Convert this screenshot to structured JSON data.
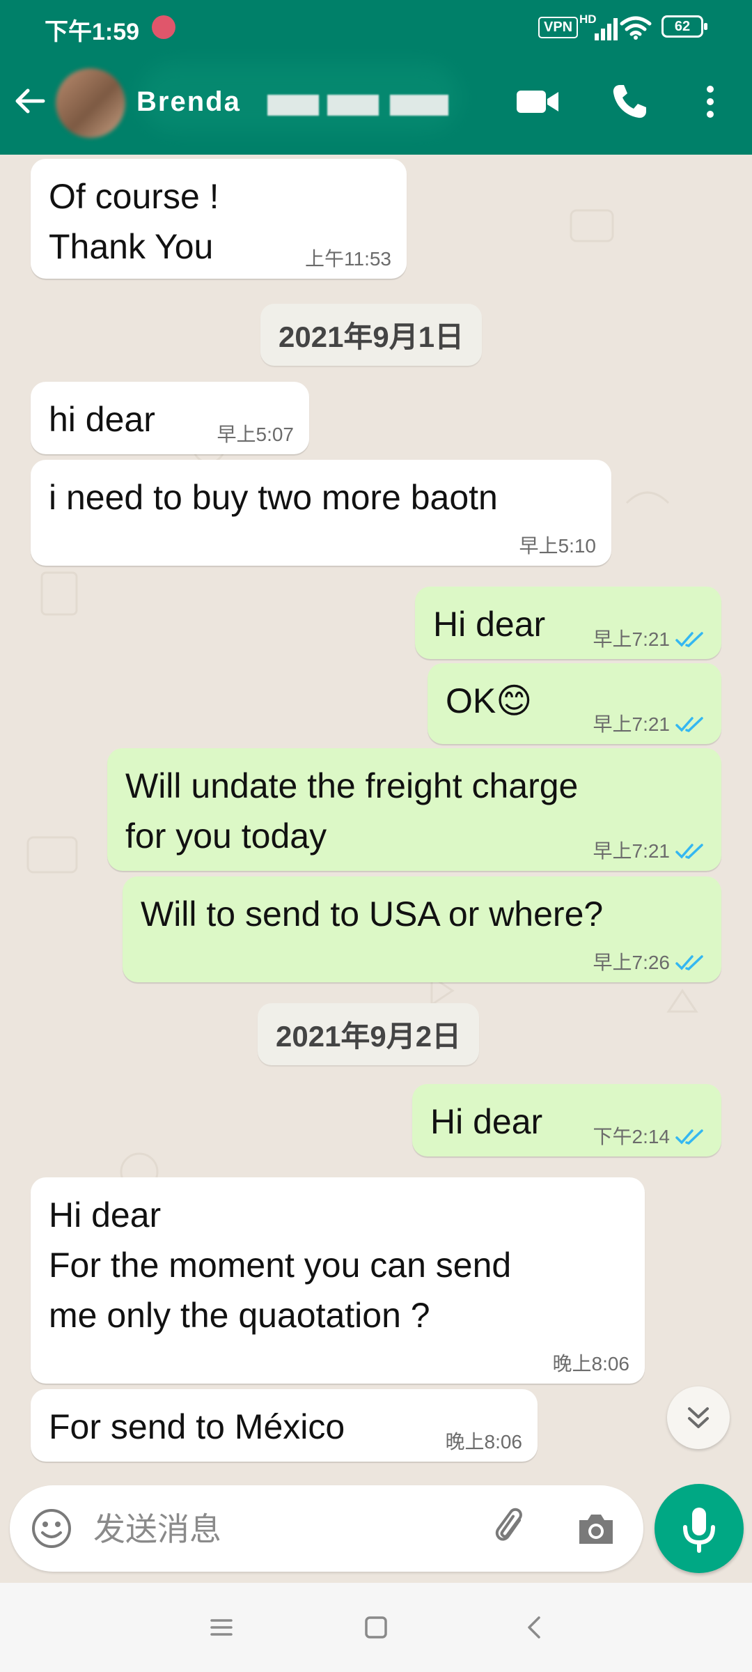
{
  "status_bar": {
    "time": "下午1:59",
    "vpn": "VPN",
    "network": "HD",
    "battery": "62"
  },
  "header": {
    "contact_name": "Brenda",
    "back_icon": "arrow-left-icon",
    "actions": [
      "video-call-icon",
      "voice-call-icon",
      "more-vert-icon"
    ],
    "color": "#008069"
  },
  "messages": [
    {
      "dir": "in",
      "text": "Of course !\nThank You",
      "time": "上午11:53"
    },
    {
      "dir": "date",
      "text": "2021年9月1日"
    },
    {
      "dir": "in",
      "text": "hi dear",
      "time": "早上5:07"
    },
    {
      "dir": "in",
      "text": "i need to buy two more baotn",
      "time": "早上5:10"
    },
    {
      "dir": "out",
      "text": "Hi dear",
      "time": "早上7:21",
      "read": true
    },
    {
      "dir": "out",
      "text": "OK😊",
      "time": "早上7:21",
      "read": true
    },
    {
      "dir": "out",
      "text": "Will undate the freight charge\nfor you today",
      "time": "早上7:21",
      "read": true
    },
    {
      "dir": "out",
      "text": "Will to send to USA or where?",
      "time": "早上7:26",
      "read": true
    },
    {
      "dir": "date",
      "text": "2021年9月2日"
    },
    {
      "dir": "out",
      "text": "Hi dear",
      "time": "下午2:14",
      "read": true
    },
    {
      "dir": "in",
      "text": "Hi dear\nFor the moment you can send\nme only the quaotation ?",
      "time": "晚上8:06"
    },
    {
      "dir": "in",
      "text": "For send to México",
      "time": "晚上8:06"
    }
  ],
  "composer": {
    "placeholder": "发送消息",
    "icons": [
      "emoji-icon",
      "attach-icon",
      "camera-icon",
      "mic-icon"
    ],
    "accent": "#00a884"
  },
  "colors": {
    "incoming_bubble": "#ffffff",
    "outgoing_bubble": "#dcf8c6",
    "read_ticks": "#34b7f1",
    "background": "#ece5dd"
  }
}
